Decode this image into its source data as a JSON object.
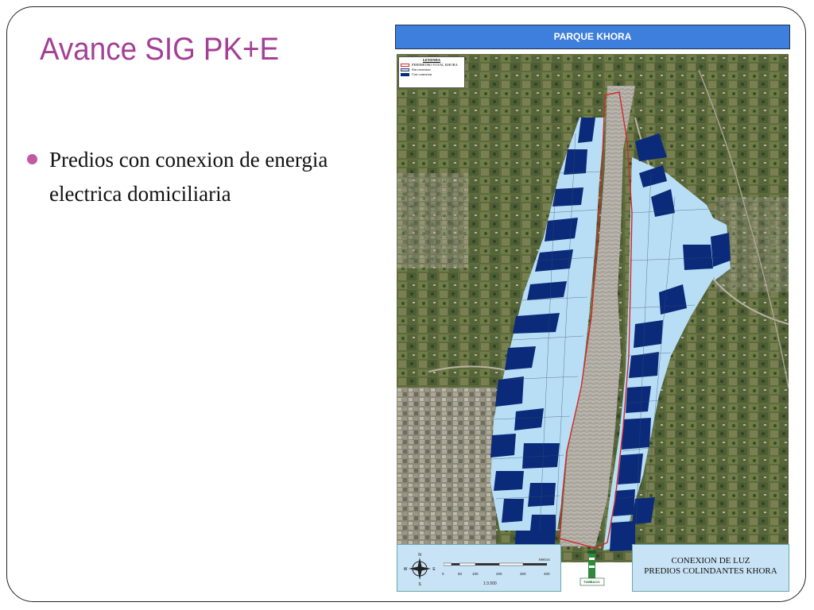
{
  "slide": {
    "title": "Avance SIG PK+E",
    "bullets": [
      "Predios con conexion de energia electrica domiciliaria"
    ]
  },
  "map": {
    "header_title": "PARQUE KHORA",
    "legend": {
      "title": "LEYENDA",
      "items": [
        {
          "label": "PERIMETRO TOTAL KHORA",
          "color": "#d0282c"
        },
        {
          "label": "Sin conexion",
          "color": "#b8def6"
        },
        {
          "label": "Con conexion",
          "color": "#0b2a7a"
        }
      ]
    },
    "scale_label": "1:3.500",
    "scale_ticks": [
      "0",
      "50",
      "100",
      "200",
      "300",
      "400"
    ],
    "scale_unit": "Metros",
    "compass_letters": {
      "north": "N",
      "south": "S",
      "east": "E",
      "west": "W"
    },
    "footer_title_line1": "CONEXION DE LUZ",
    "footer_title_line2": "PREDIOS COLINDANTES KHORA",
    "logo_text": "TUMBACO",
    "colors": {
      "header": "#3e7edc",
      "perimeter": "#d0282c",
      "sin_conexion": "#b8def6",
      "con_conexion": "#0b2a7a",
      "footer_bg": "#c8e3f5",
      "title": "#a43f96"
    }
  }
}
